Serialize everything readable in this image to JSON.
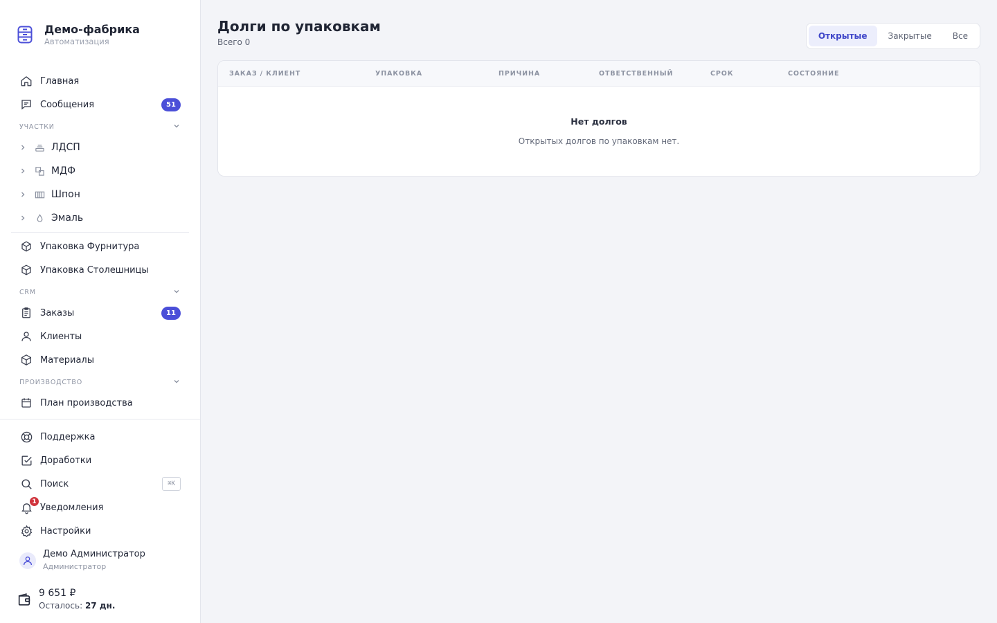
{
  "brand": {
    "title": "Демо-фабрика",
    "subtitle": "Автоматизация"
  },
  "nav_top": [
    {
      "label": "Главная",
      "icon": "home-icon"
    },
    {
      "label": "Сообщения",
      "icon": "chat-icon",
      "badge": "51"
    }
  ],
  "sections": {
    "areas": "УЧАСТКИ",
    "crm": "CRM",
    "production": "ПРОИЗВОДСТВО"
  },
  "areas": [
    {
      "label": "ЛДСП",
      "icon": "layers-icon"
    },
    {
      "label": "МДФ",
      "icon": "squares-icon"
    },
    {
      "label": "Шпон",
      "icon": "veneer-icon"
    },
    {
      "label": "Эмаль",
      "icon": "drop-icon"
    }
  ],
  "packaging": [
    {
      "label": "Упаковка Фурнитура",
      "icon": "box-icon"
    },
    {
      "label": "Упаковка Столешницы",
      "icon": "box-icon"
    }
  ],
  "crm": [
    {
      "label": "Заказы",
      "icon": "clipboard-icon",
      "badge": "11"
    },
    {
      "label": "Клиенты",
      "icon": "user-icon"
    },
    {
      "label": "Материалы",
      "icon": "cube-icon"
    }
  ],
  "production": [
    {
      "label": "План производства",
      "icon": "calendar-icon"
    }
  ],
  "bottom": {
    "support": "Поддержка",
    "improvements": "Доработки",
    "search": "Поиск",
    "search_kbd": "⌘K",
    "notifications": "Уведомления",
    "notifications_count": "1",
    "settings": "Настройки"
  },
  "user": {
    "name": "Демо Администратор",
    "role": "Администратор"
  },
  "wallet": {
    "amount": "9 651 ₽",
    "left_label": "Осталось:",
    "left_value": "27 дн."
  },
  "page": {
    "title": "Долги по упаковкам",
    "count": "Всего 0",
    "filters": [
      "Открытые",
      "Закрытые",
      "Все"
    ],
    "active_filter": "Открытые"
  },
  "table": {
    "columns": [
      "Заказ / клиент",
      "Упаковка",
      "Причина",
      "Ответственный",
      "Срок",
      "Состояние"
    ],
    "empty_title": "Нет долгов",
    "empty_text": "Открытых долгов по упаковкам нет."
  },
  "colors": {
    "accent": "#4b4fd8",
    "badge_red": "#d0333c",
    "background": "#f3f4f8"
  }
}
